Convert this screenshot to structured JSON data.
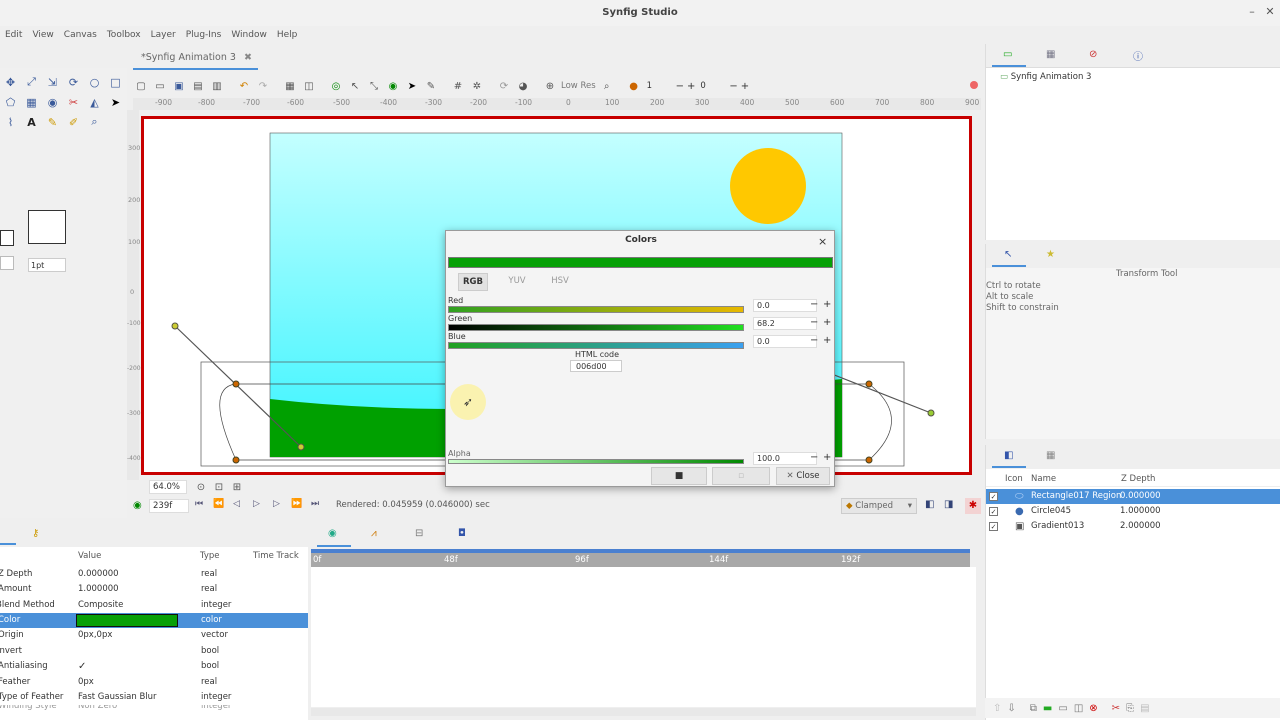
{
  "window": {
    "title": "Synfig Studio"
  },
  "menu": [
    "Edit",
    "View",
    "Canvas",
    "Toolbox",
    "Layer",
    "Plug-Ins",
    "Window",
    "Help"
  ],
  "document_tab": {
    "title": "*Synfig Animation 3",
    "close": "✖"
  },
  "toolbar": {
    "quality_label": "Low Res",
    "frame_a": "1",
    "frame_b": "0"
  },
  "ruler": {
    "h_ticks": [
      "-900",
      "-800",
      "-700",
      "-600",
      "-500",
      "-400",
      "-300",
      "-200",
      "-100",
      "0",
      "100",
      "200",
      "300",
      "400",
      "500",
      "600",
      "700",
      "800",
      "900"
    ],
    "v_ticks": [
      "300",
      "200",
      "100",
      "0",
      "-100",
      "-200",
      "-300",
      "-400"
    ]
  },
  "toolbox": {
    "width_value": "1pt"
  },
  "canvas_bottom": {
    "zoom": "64.0%",
    "frame": "239f",
    "rendered": "Rendered: 0.045959 (0.046000) sec",
    "interp": "Clamped"
  },
  "colors_dialog": {
    "title": "Colors",
    "tabs": [
      "RGB",
      "YUV",
      "HSV"
    ],
    "red_label": "Red",
    "red_value": "0.0",
    "green_label": "Green",
    "green_value": "68.2",
    "blue_label": "Blue",
    "blue_value": "0.0",
    "html_label": "HTML code",
    "html_value": "006d00",
    "alpha_label": "Alpha",
    "alpha_value": "100.0",
    "close_label": "Close"
  },
  "canvas_browser": {
    "item": "Synfig Animation 3"
  },
  "tool_options": {
    "title": "Transform Tool",
    "hints": [
      "Ctrl to rotate",
      "Alt to scale",
      "Shift to constrain"
    ]
  },
  "layers": {
    "headers": {
      "icon": "Icon",
      "name": "Name",
      "zdepth": "Z Depth"
    },
    "rows": [
      {
        "name": "Rectangle017 Region",
        "z": "0.000000",
        "selected": true
      },
      {
        "name": "Circle045",
        "z": "1.000000",
        "selected": false
      },
      {
        "name": "Gradient013",
        "z": "2.000000",
        "selected": false
      }
    ]
  },
  "params": {
    "headers": {
      "value": "Value",
      "type": "Type",
      "timetrack": "Time Track"
    },
    "rows": [
      {
        "name": "Z Depth",
        "value": "0.000000",
        "type": "real"
      },
      {
        "name": "Amount",
        "value": "1.000000",
        "type": "real"
      },
      {
        "name": "Blend Method",
        "value": "Composite",
        "type": "integer"
      },
      {
        "name": "Color",
        "value": "",
        "type": "color"
      },
      {
        "name": "Origin",
        "value": "0px,0px",
        "type": "vector"
      },
      {
        "name": "Invert",
        "value": "",
        "type": "bool"
      },
      {
        "name": "Antialiasing",
        "value": "✓",
        "type": "bool"
      },
      {
        "name": "Feather",
        "value": "0px",
        "type": "real"
      },
      {
        "name": "Type of Feather",
        "value": "Fast Gaussian Blur",
        "type": "integer"
      },
      {
        "name": "Winding Style",
        "value": "Non Zero",
        "type": "integer"
      }
    ]
  },
  "timeline": {
    "marks": [
      "0f",
      "48f",
      "96f",
      "144f",
      "192f"
    ]
  },
  "colors": {
    "accent": "#4a90d9",
    "frame_red": "#c80000",
    "grass": "#00a000",
    "sun": "#ffc800",
    "sky_top": "#b8ffff",
    "sky_bottom": "#3af2ff"
  }
}
